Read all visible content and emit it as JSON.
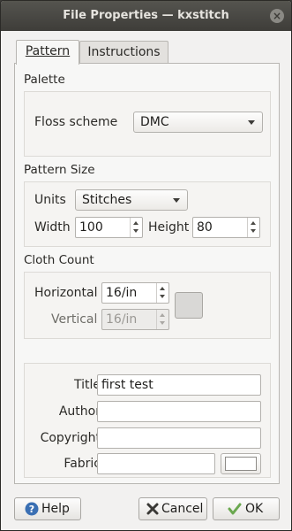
{
  "window": {
    "title": "File Properties — kxstitch"
  },
  "tabs": [
    {
      "label": "Pattern"
    },
    {
      "label": "Instructions"
    }
  ],
  "palette": {
    "section_label": "Palette",
    "floss_label": "Floss scheme",
    "floss_value": "DMC"
  },
  "pattern_size": {
    "section_label": "Pattern Size",
    "units_label": "Units",
    "units_value": "Stitches",
    "width_label": "Width",
    "width_value": "100",
    "height_label": "Height",
    "height_value": "80"
  },
  "cloth_count": {
    "section_label": "Cloth Count",
    "horizontal_label": "Horizontal",
    "horizontal_value": "16/in",
    "vertical_label": "Vertical",
    "vertical_value": "16/in"
  },
  "info": {
    "title_label": "Title",
    "title_value": "first test",
    "author_label": "Author",
    "author_value": "",
    "copyright_label": "Copyright",
    "copyright_value": "",
    "fabric_label": "Fabric",
    "fabric_value": "",
    "fabric_color": "#ffffff"
  },
  "buttons": {
    "help": "Help",
    "cancel": "Cancel",
    "ok": "OK"
  }
}
